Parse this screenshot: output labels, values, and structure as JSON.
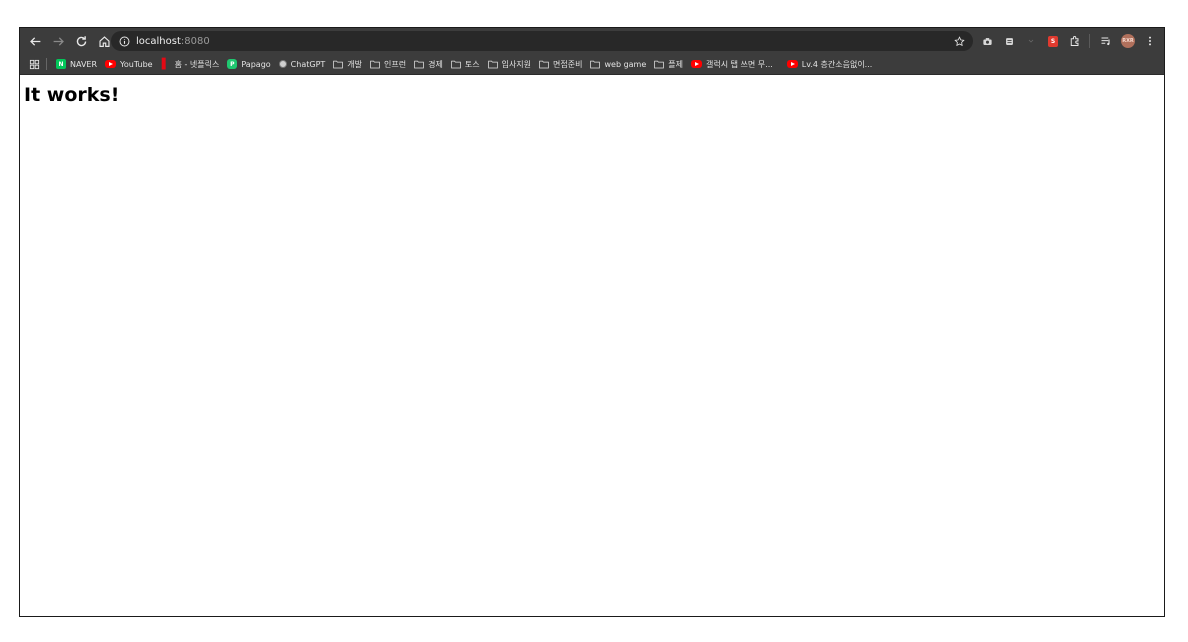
{
  "browser": {
    "url_host": "localhost",
    "url_port": ":8080",
    "profile_initials": "RXR",
    "accent_color": "#3c3c3c"
  },
  "bookmarks": [
    {
      "label": "NAVER",
      "icon": "naver-icon"
    },
    {
      "label": "YouTube",
      "icon": "youtube-icon"
    },
    {
      "label": "홈 - 넷플릭스",
      "icon": "netflix-icon"
    },
    {
      "label": "Papago",
      "icon": "papago-icon"
    },
    {
      "label": "ChatGPT",
      "icon": "chatgpt-icon"
    },
    {
      "label": "개발",
      "icon": "folder-icon"
    },
    {
      "label": "인프런",
      "icon": "folder-icon"
    },
    {
      "label": "경제",
      "icon": "folder-icon"
    },
    {
      "label": "토스",
      "icon": "folder-icon"
    },
    {
      "label": "입사지원",
      "icon": "folder-icon"
    },
    {
      "label": "면접준비",
      "icon": "folder-icon"
    },
    {
      "label": "web game",
      "icon": "folder-icon"
    },
    {
      "label": "플제",
      "icon": "folder-icon"
    },
    {
      "label": "갤럭시 탭 쓰면 무...",
      "icon": "youtube-icon"
    },
    {
      "label": "Lv.4 층간소음없이...",
      "icon": "youtube-icon"
    }
  ],
  "page": {
    "heading": "It works!"
  }
}
